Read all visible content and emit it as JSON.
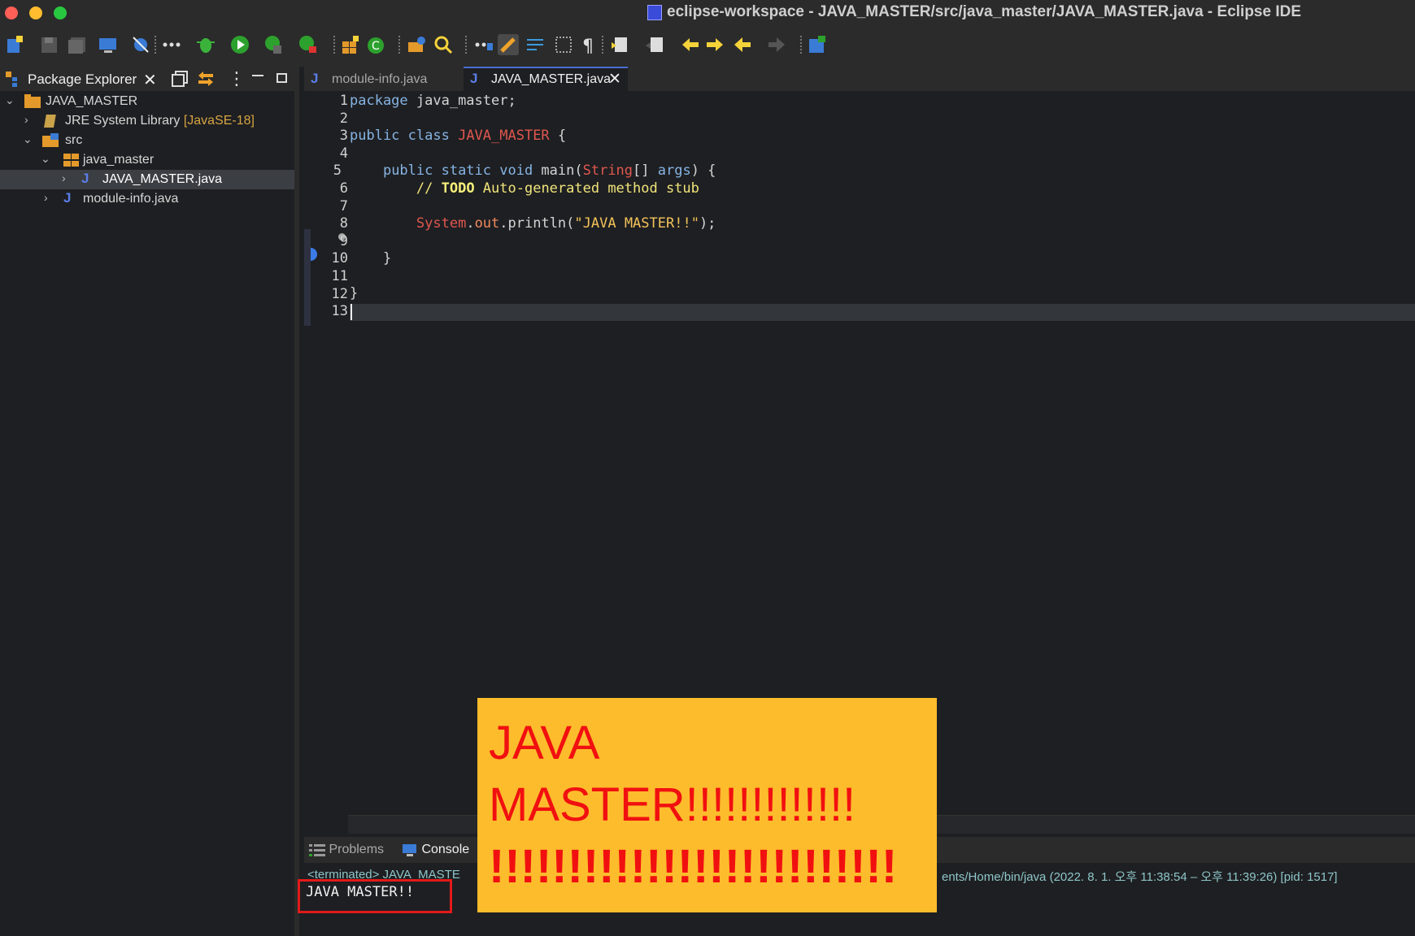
{
  "window": {
    "title": "eclipse-workspace - JAVA_MASTER/src/java_master/JAVA_MASTER.java - Eclipse IDE"
  },
  "toolbar": {
    "icons": [
      "new-icon",
      "save-icon",
      "save-all-icon",
      "terminal-icon",
      "skip-breakpoints-icon",
      "more-icon",
      "debug-icon",
      "run-icon",
      "coverage-icon",
      "external-tools-icon",
      "new-java-package-icon",
      "new-class-icon",
      "open-type-icon",
      "search-icon",
      "toggle-mark-icon",
      "highlight-icon",
      "word-wrap-icon",
      "block-select-icon",
      "show-whitespace-icon",
      "annotation-icon",
      "prev-annotation-icon",
      "last-edit-icon",
      "next-edit-icon",
      "back-icon",
      "forward-icon",
      "perspective-icon"
    ]
  },
  "package_explorer": {
    "tab_label": "Package Explorer",
    "tree": [
      {
        "label": "JAVA_MASTER",
        "suffix": ""
      },
      {
        "label": "JRE System Library",
        "suffix": "[JavaSE-18]"
      },
      {
        "label": "src",
        "suffix": ""
      },
      {
        "label": "java_master",
        "suffix": ""
      },
      {
        "label": "JAVA_MASTER.java",
        "suffix": ""
      },
      {
        "label": "module-info.java",
        "suffix": ""
      }
    ]
  },
  "editor": {
    "tabs": [
      {
        "label": "module-info.java"
      },
      {
        "label": "JAVA_MASTER.java"
      }
    ],
    "line_numbers": [
      "1",
      "2",
      "3",
      "4",
      "5",
      "6",
      "7",
      "8",
      "9",
      "10",
      "11",
      "12",
      "13"
    ],
    "code": {
      "l1_kw": "package",
      "l1_rest": " java_master;",
      "l3_kw": "public class",
      "l3_cls": "JAVA_MASTER",
      "l3_rest": " {",
      "l5_indent": "    ",
      "l5_kw": "public static void",
      "l5_name": " main(",
      "l5_type": "String",
      "l5_brackets": "[] ",
      "l5_args": "args",
      "l5_rest": ") {",
      "l6_indent": "        ",
      "l6_comment": "// ",
      "l6_todo": "TODO",
      "l6_rest": " Auto-generated method stub",
      "l8_indent": "        ",
      "l8_cls": "System",
      "l8_dot": ".",
      "l8_field": "out",
      "l8_call": ".println(",
      "l8_str": "\"JAVA MASTER!!\"",
      "l8_end": ");",
      "l10": "    }",
      "l12": "}"
    }
  },
  "console": {
    "tabs": [
      {
        "label": "Problems"
      },
      {
        "label": "Console"
      }
    ],
    "terminated_prefix": "<terminated> JAVA_MASTE",
    "terminated_suffix": "ents/Home/bin/java  (2022. 8. 1. 오후 11:38:54 – 오후 11:39:26) [pid: 1517]",
    "output": "JAVA MASTER!!"
  },
  "overlay": {
    "line1": "JAVA",
    "line2": "MASTER!!!!!!!!!!!!!",
    "line3": "!!!!!!!!!!!!!!!!!!!!!!!!!!"
  },
  "colors": {
    "accent_red": "#e21a1a",
    "overlay_bg": "#fdbc2c"
  }
}
